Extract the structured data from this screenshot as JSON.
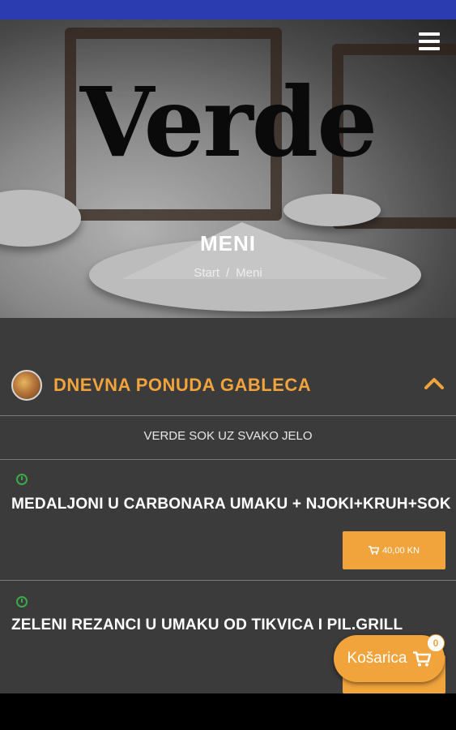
{
  "header": {
    "logo_text": "Verde",
    "page_title": "MENI",
    "breadcrumb": {
      "home": "Start",
      "separator": "/",
      "current": "Meni"
    }
  },
  "category": {
    "title": "DNEVNA PONUDA GABLECA",
    "notice": "VERDE SOK UZ SVAKO JELO",
    "expanded": true
  },
  "items": [
    {
      "name": "MEDALJONI U CARBONARA UMAKU + NJOKI+KRUH+SOK",
      "price": "40,00 KN"
    },
    {
      "name": "ZELENI REZANCI U UMAKU OD TIKVICA I PIL.GRILL",
      "price": ""
    }
  ],
  "cart": {
    "label": "Košarica",
    "count": "0"
  },
  "colors": {
    "accent": "#f1a33c",
    "status_bar": "#2b3cb0",
    "background": "#3b3b3b",
    "clock": "#3da84b"
  },
  "icons": [
    "menu-icon",
    "category-food-icon",
    "chevron-up-icon",
    "clock-icon",
    "cart-icon"
  ]
}
